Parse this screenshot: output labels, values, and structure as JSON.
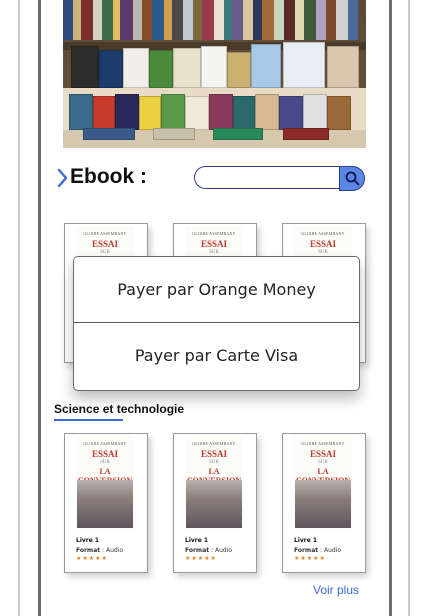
{
  "header": {
    "title": "Ebook :"
  },
  "search": {
    "placeholder": "",
    "value": ""
  },
  "payment_menu": {
    "options": [
      {
        "label": "Payer par Orange Money"
      },
      {
        "label": "Payer par Carte Visa"
      }
    ]
  },
  "top_row_books": [
    {
      "author": "GLOIRE ASSEMBANY",
      "title_a": "ESSAI",
      "title_b": "SUR"
    },
    {
      "author": "GLOIRE ASSEMBANY",
      "title_a": "ESSAI",
      "title_b": "SUR"
    },
    {
      "author": "GLOIRE ASSEMBANY",
      "title_a": "ESSAI",
      "title_b": "SUR"
    }
  ],
  "section": {
    "title": "Science et technologie",
    "books": [
      {
        "author": "GLOIRE ASSEMBANY",
        "title_a": "ESSAI",
        "title_b": "SUR",
        "title_c": "LA CONVERSION",
        "name": "Livre 1",
        "format_label": "Format",
        "format_value": ": Audio",
        "rating_stars": "★★★★★",
        "rating": 5
      },
      {
        "author": "GLOIRE ASSEMBANY",
        "title_a": "ESSAI",
        "title_b": "SUR",
        "title_c": "LA CONVERSION",
        "name": "Livre 1",
        "format_label": "Format",
        "format_value": ": Audio",
        "rating_stars": "★★★★★",
        "rating": 5
      },
      {
        "author": "GLOIRE ASSEMBANY",
        "title_a": "ESSAI",
        "title_b": "SUR",
        "title_c": "LA CONVERSION",
        "name": "Livre 1",
        "format_label": "Format",
        "format_value": ": Audio",
        "rating_stars": "★★★★★",
        "rating": 5
      }
    ],
    "more_link": "Voir plus"
  },
  "colors": {
    "accent": "#3c6bd6",
    "search_button": "#5a86e6",
    "stars": "#e67e22",
    "cover_title": "#c0392b"
  },
  "icons": {
    "section_chevron": "chevron-right-icon",
    "search": "search-icon"
  }
}
